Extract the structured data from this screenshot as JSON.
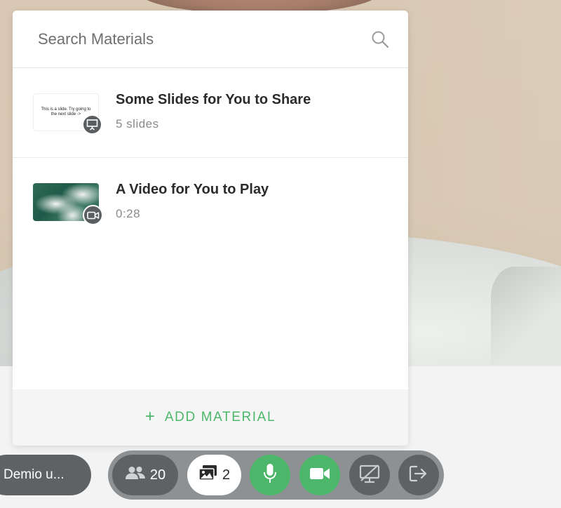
{
  "search": {
    "placeholder": "Search Materials"
  },
  "materials": [
    {
      "title": "Some Slides for You to Share",
      "meta": "5 slides",
      "thumb_text": "This is a slide. Try going to the next slide ->",
      "badge_icon": "presentation-icon"
    },
    {
      "title": "A Video for You to Play",
      "meta": "0:28",
      "badge_icon": "video-camera-icon"
    }
  ],
  "add_material": {
    "plus": "+",
    "label": "ADD MATERIAL"
  },
  "presenter": {
    "label": "Demio u..."
  },
  "controls": {
    "attendees_count": "20",
    "materials_count": "2"
  },
  "colors": {
    "accent_green": "#4cb76a",
    "dark_gray": "#5f6264",
    "bar_gray": "#8e9193"
  }
}
